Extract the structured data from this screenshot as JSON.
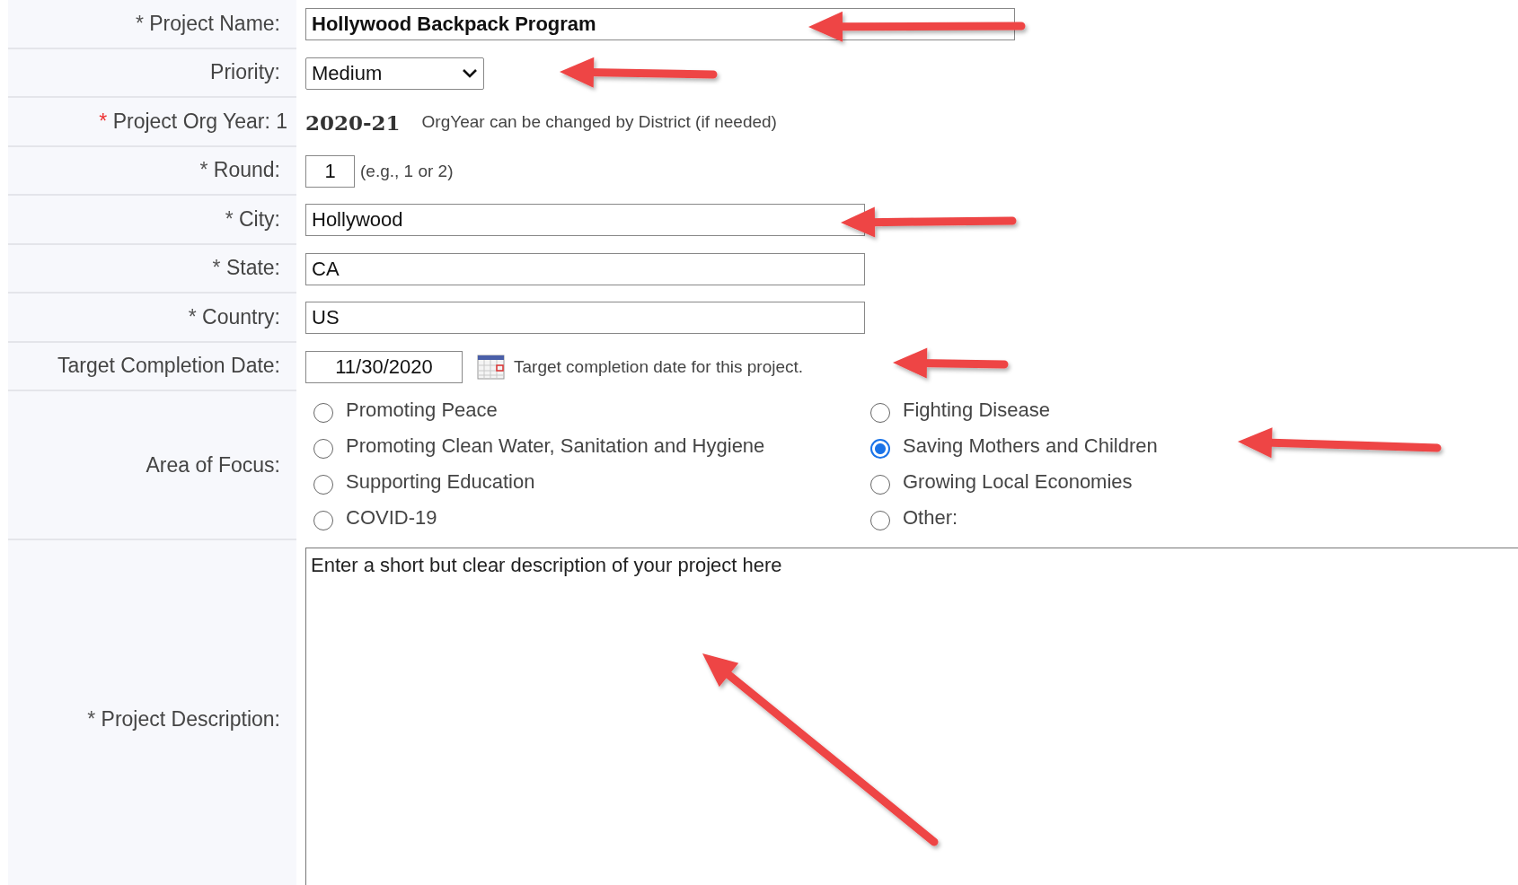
{
  "form": {
    "rows": [
      {
        "kind": "text_wide",
        "label": "Project Name:",
        "required_mark": {
          "text": "*",
          "color": "#555555"
        },
        "value": "Hollywood Backpack Program"
      },
      {
        "kind": "select",
        "label": "Priority:",
        "value": "Medium"
      },
      {
        "kind": "static",
        "label": "Project Org Year: 1",
        "required_mark": {
          "text": "*",
          "color": "#ee3333"
        },
        "value": "2020-21",
        "hint": "OrgYear can be changed by District (if needed)"
      },
      {
        "kind": "number",
        "label": "Round:",
        "required_mark": {
          "text": "*",
          "color": "#555555"
        },
        "value": "1",
        "hint": "(e.g., 1 or 2)"
      },
      {
        "kind": "text",
        "label": "City:",
        "required_mark": {
          "text": "*",
          "color": "#555555"
        },
        "value": "Hollywood"
      },
      {
        "kind": "text",
        "label": "State:",
        "required_mark": {
          "text": "*",
          "color": "#555555"
        },
        "value": "CA"
      },
      {
        "kind": "text",
        "label": "Country:",
        "required_mark": {
          "text": "*",
          "color": "#555555"
        },
        "value": "US"
      },
      {
        "kind": "date",
        "label": "Target Completion Date:",
        "value": "11/30/2020",
        "hint": "Target completion date for this project."
      },
      {
        "kind": "radio_group",
        "label": "Area of Focus:",
        "options": [
          {
            "label": "Promoting Peace",
            "selected": false
          },
          {
            "label": "Fighting Disease",
            "selected": false
          },
          {
            "label": "Promoting Clean Water, Sanitation and Hygiene",
            "selected": false
          },
          {
            "label": "Saving Mothers and Children",
            "selected": true
          },
          {
            "label": "Supporting Education",
            "selected": false
          },
          {
            "label": "Growing Local Economies",
            "selected": false
          },
          {
            "label": "COVID-19",
            "selected": false
          },
          {
            "label": "Other:",
            "selected": false
          }
        ]
      },
      {
        "kind": "textarea",
        "label": "Project Description:",
        "required_mark": {
          "text": "*",
          "color": "#555555"
        },
        "placeholder": "Enter a short but clear description of your project here"
      }
    ]
  }
}
